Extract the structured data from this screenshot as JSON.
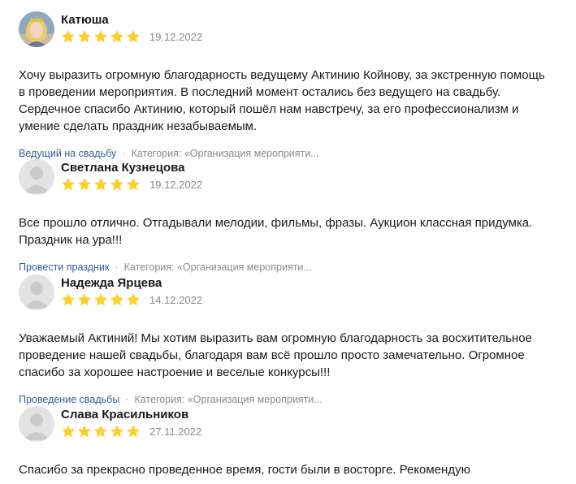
{
  "reviews": [
    {
      "name": "Катюша",
      "date": "19.12.2022",
      "rating": 5,
      "avatar": "photo-avatar",
      "text": "Хочу выразить огромную благодарность ведущему Актинию Койнову, за экстренную помощь\nв проведении мероприятия. В последний момент остались без ведущего на свадьбу.\nСердечное спасибо Актинию, который пошёл нам навстречу, за его профессионализм и\nумение сделать праздник незабываемым.",
      "service": "Ведущий на свадьбу",
      "category": "Категория: «Организация мероприяти..."
    },
    {
      "name": "Светлана Кузнецова",
      "date": "19.12.2022",
      "rating": 5,
      "avatar": "default-avatar",
      "text": "Все прошло отлично. Отгадывали мелодии, фильмы, фразы. Аукцион классная придумка.\nПраздник на ура!!!",
      "service": "Провести праздник",
      "category": "Категория: «Организация мероприяти..."
    },
    {
      "name": "Надежда Ярцева",
      "date": "14.12.2022",
      "rating": 5,
      "avatar": "default-avatar",
      "text": "Уважаемый Актиний! Мы хотим выразить вам огромную благодарность за восхитительное\nпроведение нашей свадьбы, благодаря вам всё прошло просто замечательно. Огромное\nспасибо за хорошее настроение и веселые конкурсы!!!",
      "service": "Проведение свадьбы",
      "category": "Категория: «Организация мероприяти..."
    },
    {
      "name": "Слава Красильников",
      "date": "27.11.2022",
      "rating": 5,
      "avatar": "default-avatar",
      "text": "Спасибо за прекрасно проведенное время, гости были в восторге. Рекомендую",
      "service": "",
      "category": ""
    }
  ],
  "colors": {
    "star": "#fcd02c",
    "link": "#2f5f9a",
    "muted": "#8a8a8a"
  }
}
